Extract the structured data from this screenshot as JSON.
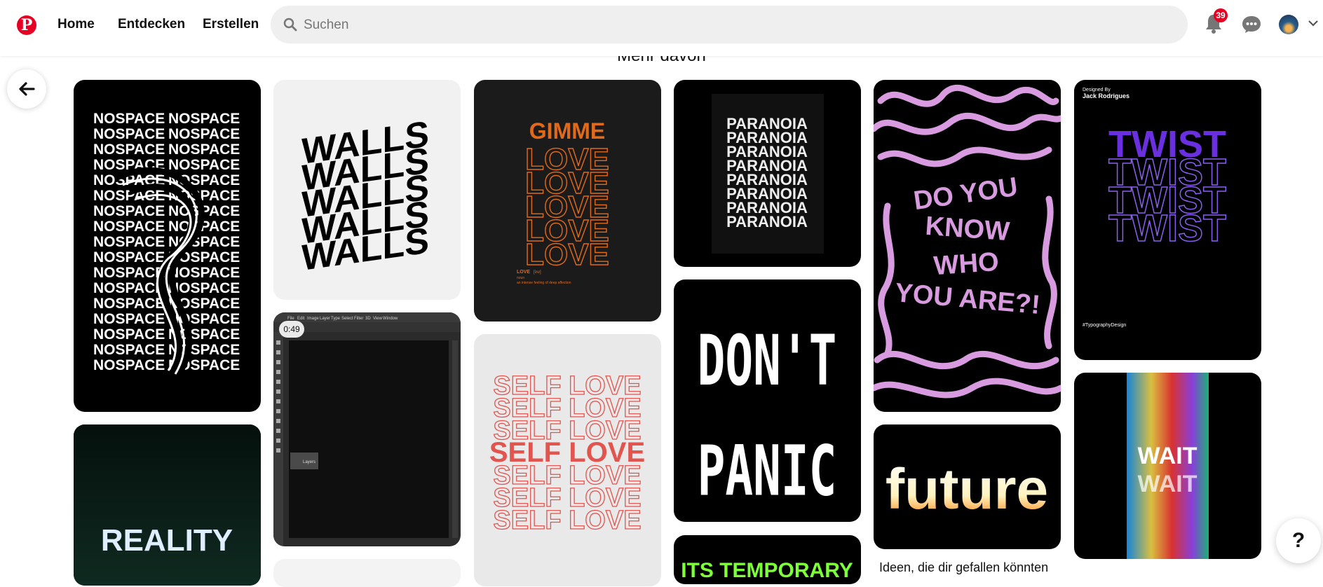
{
  "nav": {
    "home": "Home",
    "explore": "Entdecken",
    "create": "Erstellen"
  },
  "search": {
    "placeholder": "Suchen"
  },
  "notifications": {
    "count": "39"
  },
  "section_title": "Mehr davon",
  "ideas_title": "Ideen, die dir gefallen könnten",
  "help_label": "?",
  "pins": {
    "nospace": "NOSPACE",
    "walls": "WALLS",
    "reality": "REALITY",
    "video_duration": "0:49",
    "ps_menu": [
      "File",
      "Edit",
      "Image",
      "Layer",
      "Type",
      "Select",
      "Filter",
      "3D",
      "View",
      "Window"
    ],
    "ps_layers": "Layers",
    "gimme": "GIMME",
    "love": "LOVE",
    "love_def_word": "LOVE",
    "love_def_phon": "[lʌv]",
    "love_def_pos": "noun",
    "love_def_text": "an intense feeling of deep affection",
    "self_love": "SELF LOVE",
    "paranoia": "PARANOIA",
    "dont": "DON'T",
    "panic": "PANIC",
    "temporary": "ITS TEMPORARY",
    "doyou_1": "DO YOU",
    "doyou_2": "KNOW",
    "doyou_3": "WHO",
    "doyou_4": "YOU ARE?!",
    "future": "future",
    "twist_designed": "Designed By",
    "twist_author": "Jack Rodrigues",
    "twist": "TWIST",
    "twist_tag": "#TypographyDesign",
    "wait": "WAIT"
  },
  "colors": {
    "brand": "#e60023",
    "gimme": "#e06a1c",
    "self_love": "#e2554f",
    "twist": "#6a2fe0",
    "doyou": "#d89be0"
  }
}
